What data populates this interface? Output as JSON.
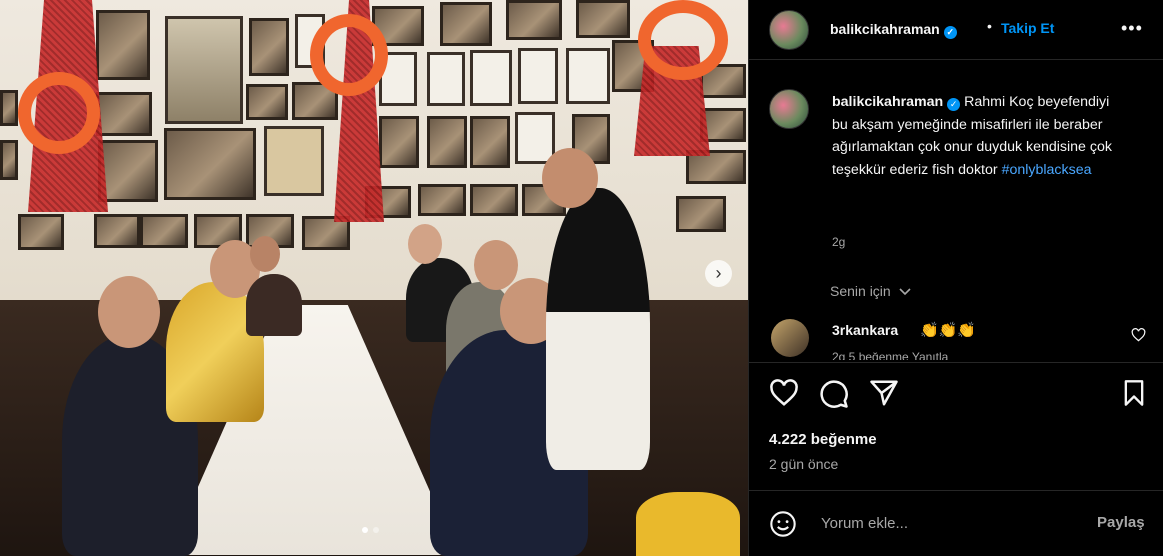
{
  "post": {
    "username": "balikcikahraman",
    "verified": true,
    "follow_label": "Takip Et",
    "separator": "•",
    "more_label": "•••",
    "caption": "Rahmi Koç beyefendiyi bu akşam yemeğinde misafirleri ile beraber ağırlamaktan çok onur duyduk kendisine çok teşekkür ederiz fish doktor",
    "hashtag": "#onlyblacksea",
    "caption_age": "2g",
    "for_you_label": "Senin için",
    "comments": [
      {
        "username": "3rkankara",
        "text": "👏👏👏",
        "partial_meta": "2g    5 beğenme    Yanıtla"
      }
    ],
    "likes": "4.222 beğenme",
    "posted": "2 gün önce",
    "comment_placeholder": "Yorum ekle...",
    "share_label": "Paylaş",
    "carousel": {
      "slides": 2,
      "current": 1
    }
  },
  "icons": {
    "like": "heart-icon",
    "comment": "comment-icon",
    "share": "paper-plane-icon",
    "save": "bookmark-icon",
    "emoji": "smiley-icon",
    "chevron": "chevron-down-icon",
    "next": "chevron-right-icon"
  },
  "colors": {
    "accent": "#0095f6",
    "hashtag": "#4aa7ff",
    "background": "#000000",
    "secondary_text": "#a8a8a8"
  }
}
